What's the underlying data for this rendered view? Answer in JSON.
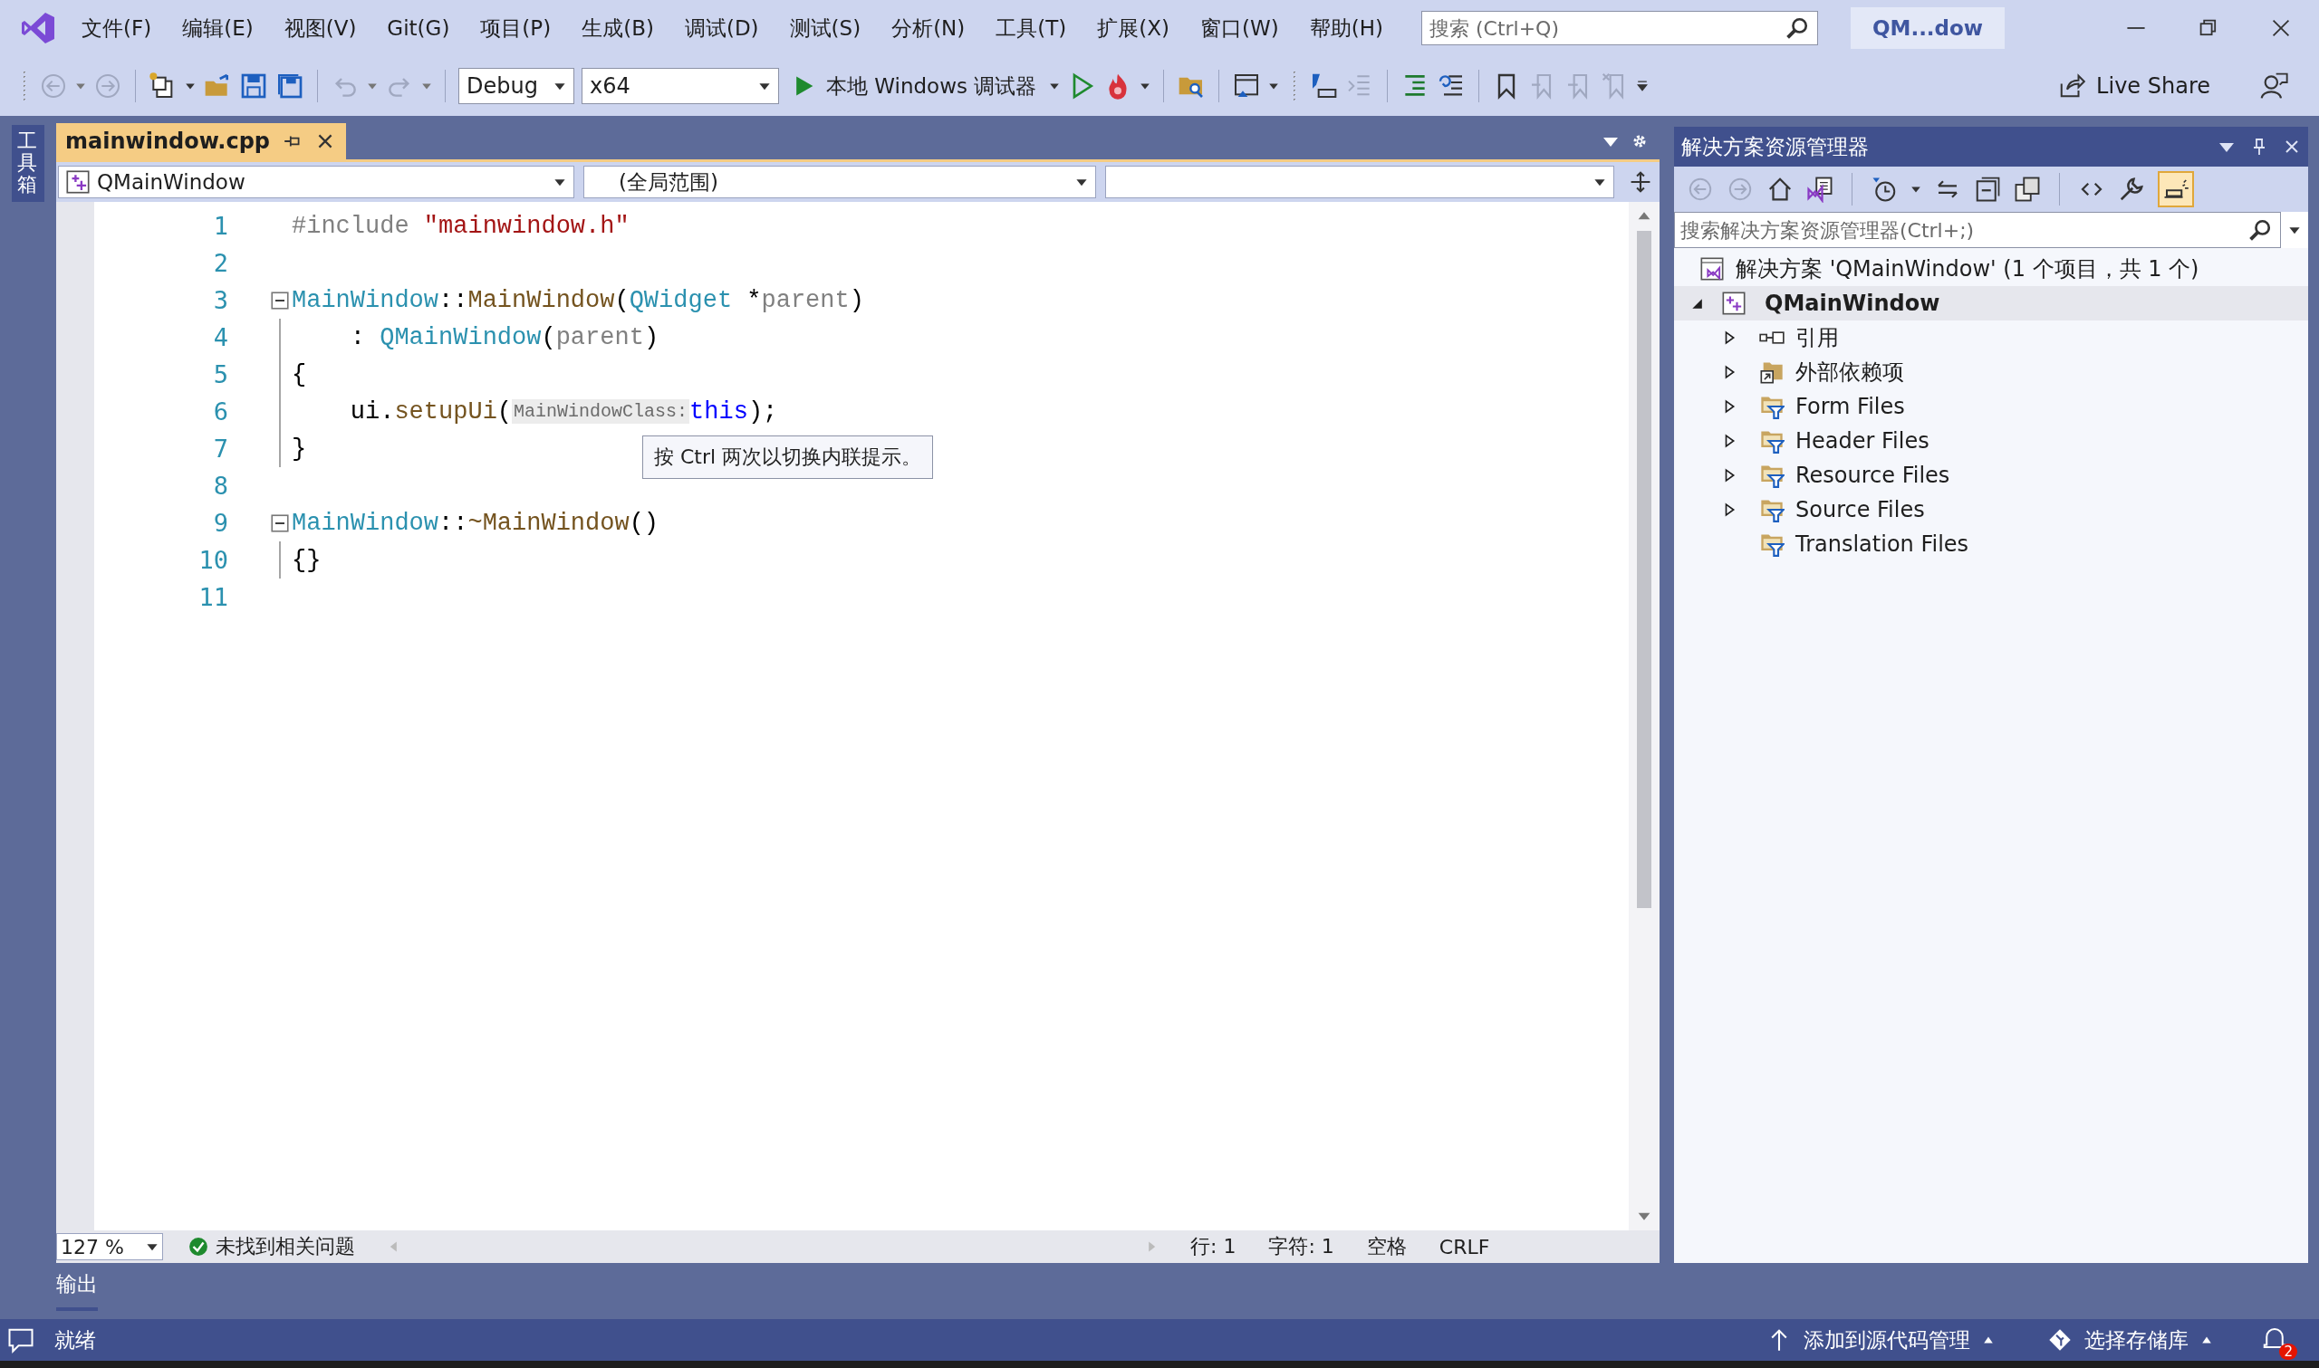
{
  "title_bar": {
    "menus": [
      "文件(F)",
      "编辑(E)",
      "视图(V)",
      "Git(G)",
      "项目(P)",
      "生成(B)",
      "调试(D)",
      "测试(S)",
      "分析(N)",
      "工具(T)",
      "扩展(X)",
      "窗口(W)",
      "帮助(H)"
    ],
    "search": {
      "placeholder": "搜索 (Ctrl+Q)"
    },
    "solution_name": "QM...dow"
  },
  "toolbar": {
    "configuration": "Debug",
    "platform": "x64",
    "debugger": "本地 Windows 调试器",
    "live_share": "Live Share"
  },
  "toolbox_tab": "工具箱",
  "editor": {
    "tabs": [
      {
        "label": "mainwindow.cpp",
        "selected": true
      }
    ],
    "nav": {
      "class": "QMainWindow",
      "scope": "(全局范围)"
    },
    "lines": [
      {
        "number": "1",
        "fold": false,
        "guide": false,
        "tokens": [
          {
            "kind": "preproc",
            "text": "#include"
          },
          {
            "kind": "string",
            "text": " \"mainwindow.h\""
          }
        ]
      },
      {
        "number": "2",
        "fold": false,
        "guide": false
      },
      {
        "number": "3",
        "fold": true,
        "guide": false,
        "tokens": [
          {
            "kind": "type",
            "text": "MainWindow"
          },
          {
            "kind": "plain",
            "text": "::"
          },
          {
            "kind": "function",
            "text": "MainWindow"
          },
          {
            "kind": "plain",
            "text": "("
          },
          {
            "kind": "type",
            "text": "QWidget"
          },
          {
            "kind": "plain",
            "text": " *"
          },
          {
            "kind": "param",
            "text": "parent"
          },
          {
            "kind": "plain",
            "text": ")"
          }
        ]
      },
      {
        "number": "4",
        "fold": false,
        "guide": true,
        "tokens": [
          {
            "kind": "plain",
            "text": "    : "
          },
          {
            "kind": "type",
            "text": "QMainWindow"
          },
          {
            "kind": "plain",
            "text": "("
          },
          {
            "kind": "param",
            "text": "parent"
          },
          {
            "kind": "plain",
            "text": ")"
          }
        ]
      },
      {
        "number": "5",
        "fold": false,
        "guide": true,
        "tokens": [
          {
            "kind": "plain",
            "text": "{"
          }
        ]
      },
      {
        "number": "6",
        "fold": false,
        "guide": true,
        "tokens": [
          {
            "kind": "plain",
            "text": "    ui."
          },
          {
            "kind": "function",
            "text": "setupUi"
          },
          {
            "kind": "plain",
            "text": "("
          },
          {
            "kind": "hint",
            "text": "MainWindowClass:"
          },
          {
            "kind": "keyword",
            "text": "this"
          },
          {
            "kind": "plain",
            "text": ");"
          }
        ]
      },
      {
        "number": "7",
        "fold": false,
        "guide": true,
        "tokens": [
          {
            "kind": "plain",
            "text": "}"
          }
        ]
      },
      {
        "number": "8",
        "fold": false,
        "guide": false
      },
      {
        "number": "9",
        "fold": true,
        "guide": false,
        "tokens": [
          {
            "kind": "type",
            "text": "MainWindow"
          },
          {
            "kind": "plain",
            "text": "::"
          },
          {
            "kind": "function",
            "text": "~MainWindow"
          },
          {
            "kind": "plain",
            "text": "()"
          }
        ]
      },
      {
        "number": "10",
        "fold": false,
        "guide": true,
        "tokens": [
          {
            "kind": "plain",
            "text": "{}"
          }
        ]
      },
      {
        "number": "11",
        "fold": false,
        "guide": false
      }
    ],
    "tooltip": "按 Ctrl 两次以切换内联提示。",
    "zoom": "127 %",
    "issues": "未找到相关问题",
    "line": "行: 1",
    "char": "字符: 1",
    "whitespace": "空格",
    "eol": "CRLF"
  },
  "output_tab": "输出",
  "solution_explorer": {
    "title": "解决方案资源管理器",
    "preview_toggle": {
      "on": true
    },
    "search": {
      "placeholder": "搜索解决方案资源管理器(Ctrl+;)"
    },
    "solution": "解决方案 'QMainWindow' (1 个项目，共 1 个)",
    "project": {
      "label": "QMainWindow",
      "expanded": true,
      "selected": true,
      "children": [
        {
          "label": "引用",
          "kind": "references",
          "expandable": true
        },
        {
          "label": "外部依赖项",
          "kind": "external",
          "expandable": true
        },
        {
          "label": "Form Files",
          "kind": "filter",
          "expandable": true
        },
        {
          "label": "Header Files",
          "kind": "filter",
          "expandable": true
        },
        {
          "label": "Resource Files",
          "kind": "filter",
          "expandable": true
        },
        {
          "label": "Source Files",
          "kind": "filter",
          "expandable": true
        },
        {
          "label": "Translation Files",
          "kind": "filter",
          "expandable": false
        }
      ]
    }
  },
  "status_bar": {
    "state": "就绪",
    "source_control": "添加到源代码管理",
    "repo": "选择存储库",
    "notifications": "2"
  }
}
